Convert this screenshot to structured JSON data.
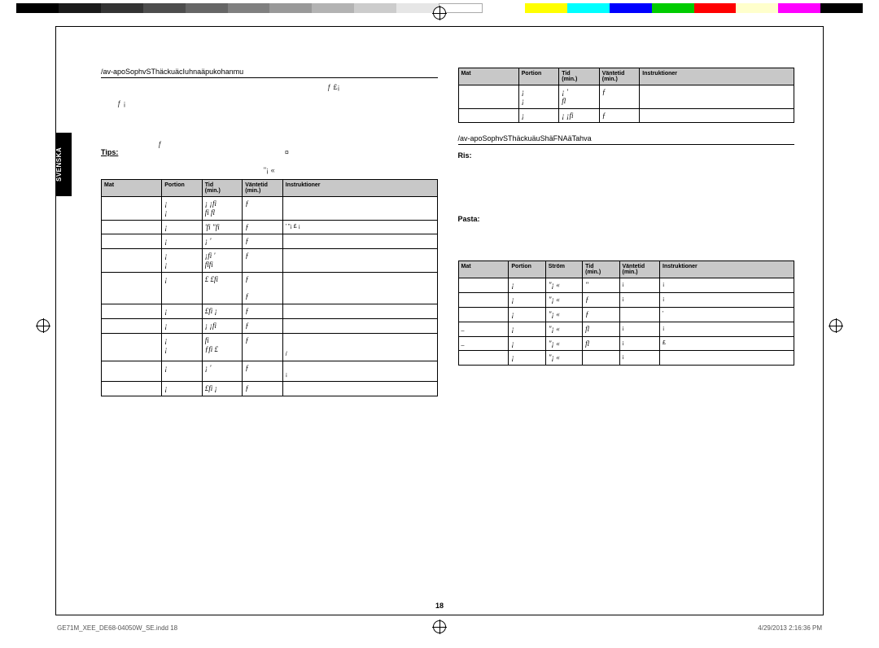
{
  "side_tab": "SVENSKA",
  "left": {
    "path": "/av-apoSophvSThäckuäcIuhnaäpukohanmu",
    "garble_top": "ƒ   £¡",
    "garble_mid1": "ƒ         ¡",
    "garble_mid2": "ƒ",
    "tips_label": "Tips:",
    "tips_garble": "¤",
    "quote_garble": "\"¡  «",
    "table": {
      "headers": [
        "Mat",
        "Portion",
        "Tid\n(min.)",
        "Väntetid\n(min.)",
        "Instruktioner"
      ],
      "rows": [
        {
          "c0": "",
          "c1": "¡\n¡",
          "c2": "¡ ¡fi\nfi fl",
          "c3": "ƒ",
          "c4": ""
        },
        {
          "c0": "",
          "c1": "¡",
          "c2": "'fi \"fi",
          "c3": "ƒ",
          "c4": "'  \"¡    £ ¡"
        },
        {
          "c0": "",
          "c1": "¡",
          "c2": "¡ '",
          "c3": "ƒ",
          "c4": ""
        },
        {
          "c0": "",
          "c1": "¡\n¡",
          "c2": "¡fi '\nflfi",
          "c3": "ƒ",
          "c4": ""
        },
        {
          "c0": "",
          "c1": "¡",
          "c2": "£ £fi",
          "c3": "ƒ\n\nƒ",
          "c4": ""
        },
        {
          "c0": "",
          "c1": "¡",
          "c2": "£fi ¡",
          "c3": "ƒ",
          "c4": ""
        },
        {
          "c0": "",
          "c1": "¡",
          "c2": "¡ ¡fi",
          "c3": "ƒ",
          "c4": ""
        },
        {
          "c0": "",
          "c1": "¡\n¡",
          "c2": "fi\nƒfi £",
          "c3": "ƒ",
          "c4": "\n\n                                    /"
        },
        {
          "c0": "",
          "c1": "¡",
          "c2": "¡ '",
          "c3": "ƒ",
          "c4": "\n¡"
        },
        {
          "c0": "",
          "c1": "¡",
          "c2": "£fi ¡",
          "c3": "ƒ",
          "c4": ""
        }
      ]
    }
  },
  "right": {
    "table1": {
      "headers": [
        "Mat",
        "Portion",
        "Tid\n(min.)",
        "Väntetid\n(min.)",
        "Instruktioner"
      ],
      "rows": [
        {
          "c0": "",
          "c1": "¡\n¡",
          "c2": "¡ '\nfl",
          "c3": "ƒ",
          "c4": ""
        },
        {
          "c0": "",
          "c1": "¡",
          "c2": "¡ ¡fi",
          "c3": "ƒ",
          "c4": ""
        }
      ]
    },
    "path": "/av-apoSophvSThäckuäuShäFNAäTahva",
    "ris_label": "Ris:",
    "pasta_label": "Pasta:",
    "table2": {
      "headers": [
        "Mat",
        "Portion",
        "Ström",
        "Tid\n(min.)",
        "Väntetid\n(min.)",
        "Instruktioner"
      ],
      "rows": [
        {
          "c0": "",
          "c1": "¡",
          "c2": "\"¡  «",
          "c3": "  \"",
          "c4": "¡",
          "c5": "¡"
        },
        {
          "c0": "",
          "c1": "¡",
          "c2": "\"¡  «",
          "c3": "ƒ",
          "c4": "¡",
          "c5": "¡"
        },
        {
          "c0": "",
          "c1": "¡",
          "c2": "\"¡  «",
          "c3": "ƒ",
          "c4": "",
          "c5": "'"
        },
        {
          "c0": "  _",
          "c1": "¡",
          "c2": "\"¡  «",
          "c3": "  fl",
          "c4": "¡",
          "c5": "¡"
        },
        {
          "c0": "  _",
          "c1": "¡",
          "c2": "\"¡  «",
          "c3": "fl",
          "c4": "¡",
          "c5": "£"
        },
        {
          "c0": "",
          "c1": "¡",
          "c2": "\"¡  «",
          "c3": "",
          "c4": "¡",
          "c5": ""
        }
      ]
    }
  },
  "page_num": "18",
  "footer_left": "GE71M_XEE_DE68-04050W_SE.indd   18",
  "footer_right": "4/29/2013   2:16:36 PM"
}
